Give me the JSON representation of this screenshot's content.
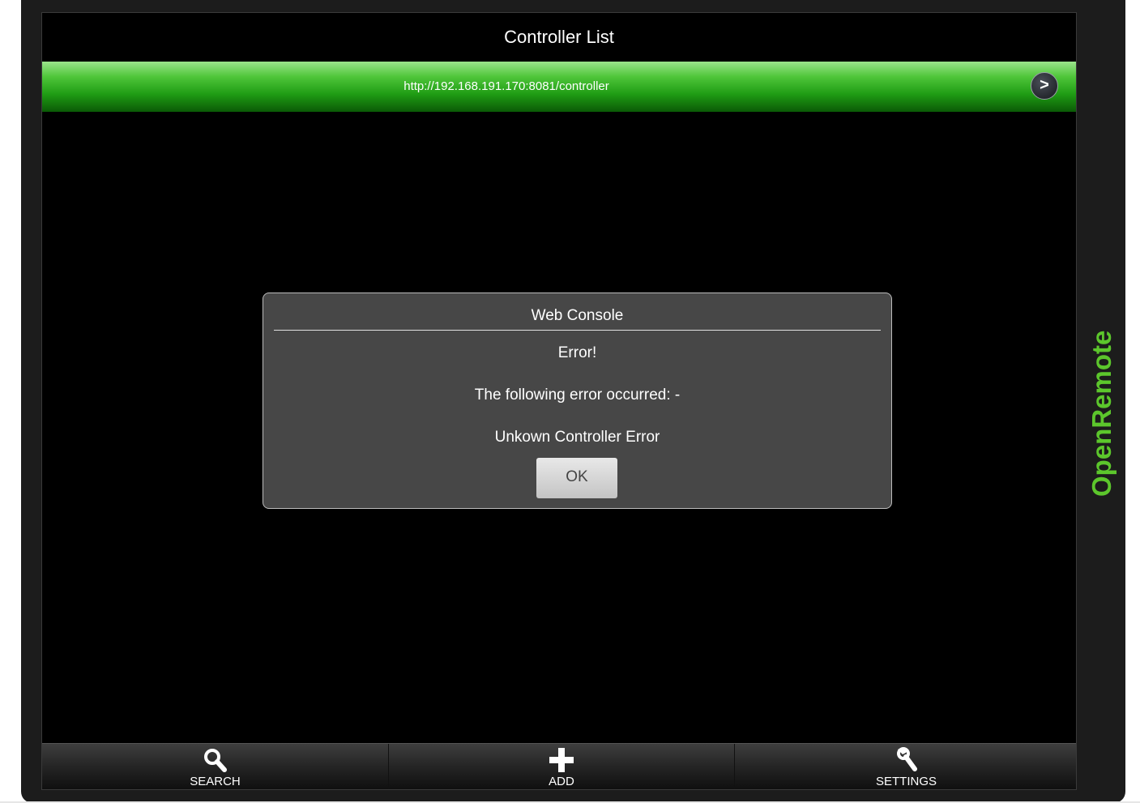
{
  "header": {
    "title": "Controller List"
  },
  "controller": {
    "url": "http://192.168.191.170:8081/controller",
    "go_label": ">"
  },
  "dialog": {
    "title": "Web Console",
    "heading": "Error!",
    "message": "The following error occurred: -",
    "detail": "Unkown Controller Error",
    "ok_label": "OK"
  },
  "tabs": [
    {
      "label": "SEARCH",
      "icon": "search-icon"
    },
    {
      "label": "ADD",
      "icon": "plus-icon"
    },
    {
      "label": "SETTINGS",
      "icon": "wrench-icon"
    }
  ],
  "brand": {
    "name": "OpenRemote",
    "color": "#5cc62c"
  },
  "colors": {
    "accent": "#2aa91a",
    "dialog_bg": "#474747"
  }
}
